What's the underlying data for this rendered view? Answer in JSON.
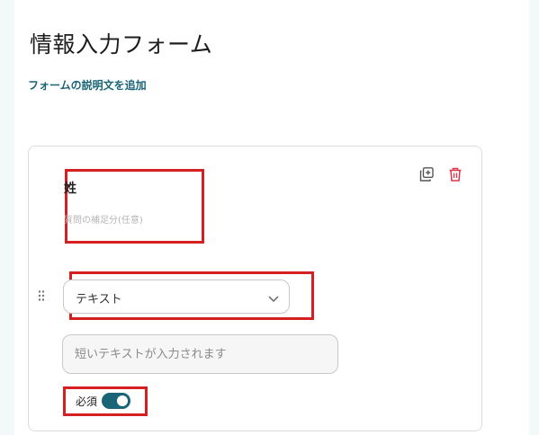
{
  "form": {
    "title": "情報入力フォーム",
    "description_link": "フォームの説明文を追加"
  },
  "question": {
    "title": "姓",
    "hint_placeholder": "質問の補足分(任意)",
    "type_select_value": "テキスト",
    "answer_placeholder": "短いテキストが入力されます",
    "required_label": "必須",
    "required": true
  },
  "icons": {
    "duplicate": "duplicate-icon",
    "delete": "trash-icon",
    "drag": "drag-handle-icon",
    "chevron": "chevron-down-icon"
  },
  "colors": {
    "accent": "#1a6478",
    "delete": "#e0344a",
    "highlight": "#d42020"
  }
}
